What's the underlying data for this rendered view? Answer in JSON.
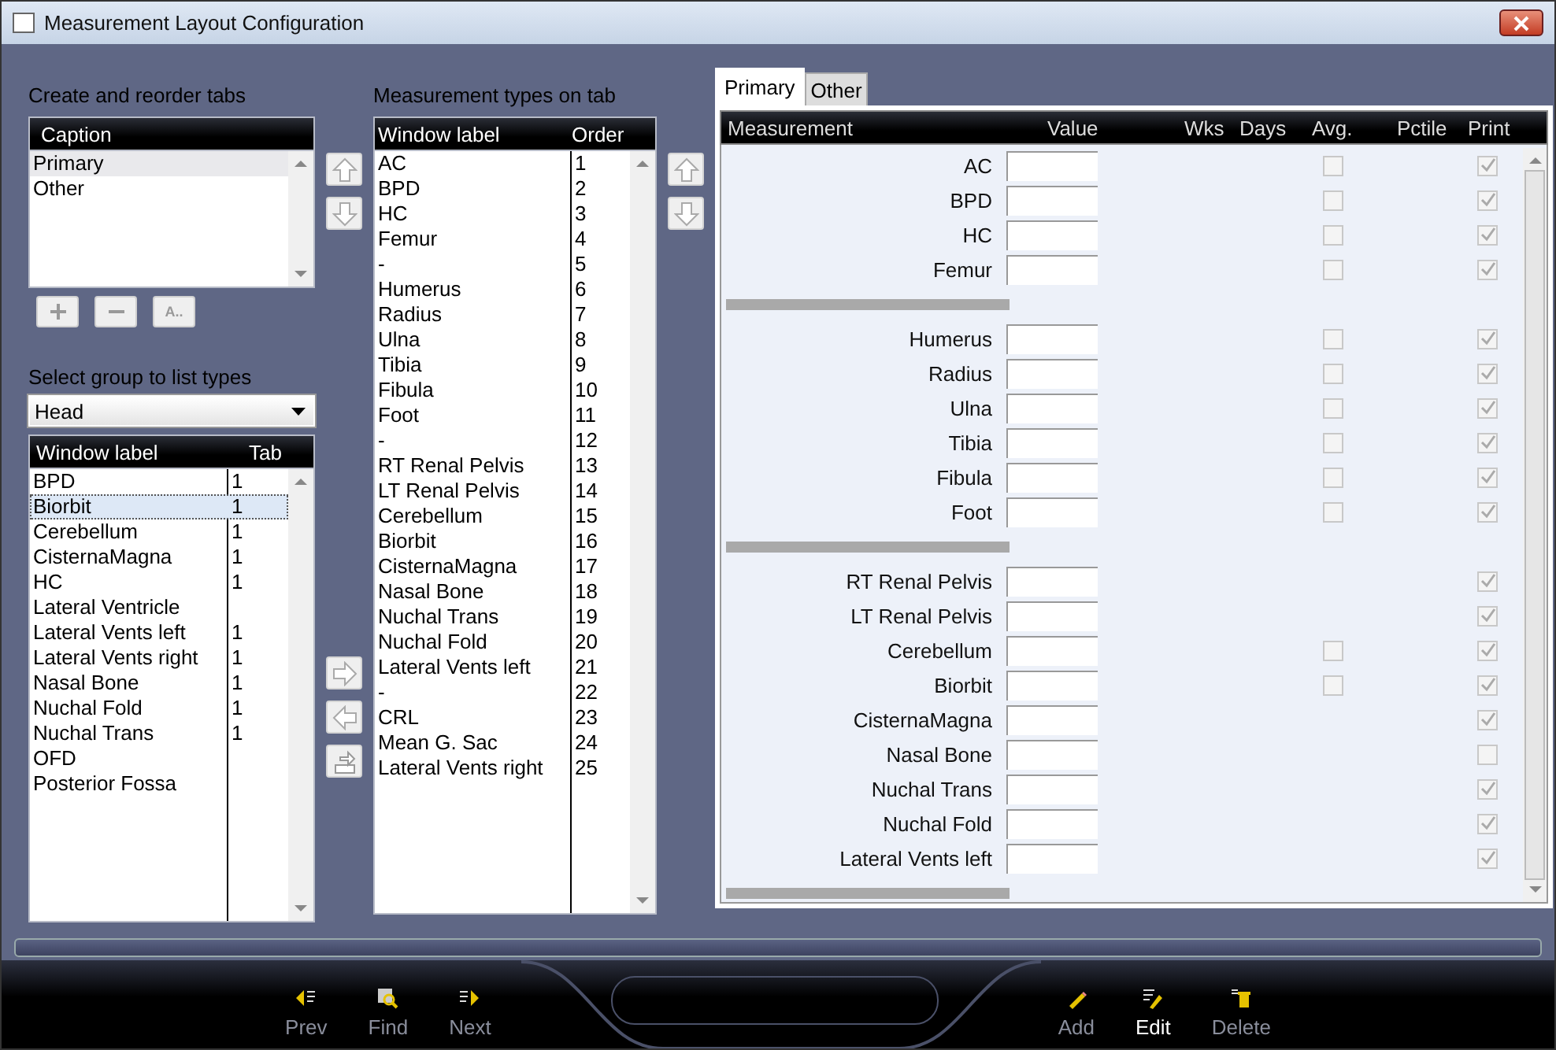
{
  "window": {
    "title": "Measurement Layout Configuration"
  },
  "tabs_editor": {
    "heading": "Create and reorder tabs",
    "column": "Caption",
    "items": [
      {
        "label": "Primary",
        "selected": true
      },
      {
        "label": "Other",
        "selected": false
      }
    ],
    "buttons": [
      {
        "kind": "add"
      },
      {
        "kind": "remove"
      },
      {
        "kind": "rename",
        "label": "A.."
      }
    ]
  },
  "group_picker": {
    "heading": "Select group to list types",
    "value": "Head",
    "columns": [
      "Window label",
      "Tab"
    ],
    "rows": [
      {
        "label": "BPD",
        "tab": "1",
        "selected": false
      },
      {
        "label": "Biorbit",
        "tab": "1",
        "selected": true
      },
      {
        "label": "Cerebellum",
        "tab": "1",
        "selected": false
      },
      {
        "label": "CisternaMagna",
        "tab": "1",
        "selected": false
      },
      {
        "label": "HC",
        "tab": "1",
        "selected": false
      },
      {
        "label": "Lateral Ventricle",
        "selected": false
      },
      {
        "label": "Lateral Vents left",
        "tab": "1",
        "selected": false
      },
      {
        "label": "Lateral Vents right",
        "tab": "1",
        "selected": false
      },
      {
        "label": "Nasal Bone",
        "tab": "1",
        "selected": false
      },
      {
        "label": "Nuchal Fold",
        "tab": "1",
        "selected": false
      },
      {
        "label": "Nuchal Trans",
        "tab": "1",
        "selected": false
      },
      {
        "label": "OFD",
        "selected": false
      },
      {
        "label": "Posterior Fossa",
        "selected": false
      }
    ]
  },
  "types_on_tab": {
    "heading": "Measurement types on tab",
    "columns": [
      "Window label",
      "Order"
    ],
    "rows": [
      {
        "label": "AC",
        "order": "1"
      },
      {
        "label": "BPD",
        "order": "2"
      },
      {
        "label": "HC",
        "order": "3"
      },
      {
        "label": "Femur",
        "order": "4"
      },
      {
        "label": "-",
        "order": "5"
      },
      {
        "label": "Humerus",
        "order": "6"
      },
      {
        "label": "Radius",
        "order": "7"
      },
      {
        "label": "Ulna",
        "order": "8"
      },
      {
        "label": "Tibia",
        "order": "9"
      },
      {
        "label": "Fibula",
        "order": "10"
      },
      {
        "label": "Foot",
        "order": "11"
      },
      {
        "label": "-",
        "order": "12"
      },
      {
        "label": "RT Renal Pelvis",
        "order": "13"
      },
      {
        "label": "LT Renal Pelvis",
        "order": "14"
      },
      {
        "label": "Cerebellum",
        "order": "15"
      },
      {
        "label": "Biorbit",
        "order": "16"
      },
      {
        "label": "CisternaMagna",
        "order": "17"
      },
      {
        "label": "Nasal Bone",
        "order": "18"
      },
      {
        "label": "Nuchal Trans",
        "order": "19"
      },
      {
        "label": "Nuchal Fold",
        "order": "20"
      },
      {
        "label": "Lateral Vents left",
        "order": "21"
      },
      {
        "label": "-",
        "order": "22"
      },
      {
        "label": "CRL",
        "order": "23"
      },
      {
        "label": "Mean G. Sac",
        "order": "24"
      },
      {
        "label": "Lateral Vents right",
        "order": "25"
      }
    ]
  },
  "preview": {
    "tabs": [
      {
        "label": "Primary",
        "selected": true
      },
      {
        "label": "Other",
        "selected": false
      }
    ],
    "columns": [
      "Measurement",
      "Value",
      "Wks",
      "Days",
      "Avg.",
      "Pctile",
      "Print"
    ],
    "rows": [
      {
        "kind": "row",
        "label": "AC",
        "avg": {
          "checked": false
        },
        "print": true
      },
      {
        "kind": "row",
        "label": "BPD",
        "avg": {
          "checked": false
        },
        "print": true
      },
      {
        "kind": "row",
        "label": "HC",
        "avg": {
          "checked": false
        },
        "print": true
      },
      {
        "kind": "row",
        "label": "Femur",
        "avg": {
          "checked": false
        },
        "print": true
      },
      {
        "kind": "separator"
      },
      {
        "kind": "row",
        "label": "Humerus",
        "avg": {
          "checked": false
        },
        "print": true
      },
      {
        "kind": "row",
        "label": "Radius",
        "avg": {
          "checked": false
        },
        "print": true
      },
      {
        "kind": "row",
        "label": "Ulna",
        "avg": {
          "checked": false
        },
        "print": true
      },
      {
        "kind": "row",
        "label": "Tibia",
        "avg": {
          "checked": false
        },
        "print": true
      },
      {
        "kind": "row",
        "label": "Fibula",
        "avg": {
          "checked": false
        },
        "print": true
      },
      {
        "kind": "row",
        "label": "Foot",
        "avg": {
          "checked": false
        },
        "print": true
      },
      {
        "kind": "separator"
      },
      {
        "kind": "row",
        "label": "RT Renal Pelvis",
        "print": true
      },
      {
        "kind": "row",
        "label": "LT Renal Pelvis",
        "print": true
      },
      {
        "kind": "row",
        "label": "Cerebellum",
        "avg": {
          "checked": false
        },
        "print": true
      },
      {
        "kind": "row",
        "label": "Biorbit",
        "avg": {
          "checked": false
        },
        "print": true
      },
      {
        "kind": "row",
        "label": "CisternaMagna",
        "print": true
      },
      {
        "kind": "row",
        "label": "Nasal Bone",
        "print": false
      },
      {
        "kind": "row",
        "label": "Nuchal Trans",
        "print": true
      },
      {
        "kind": "row",
        "label": "Nuchal Fold",
        "print": true
      },
      {
        "kind": "row",
        "label": "Lateral Vents left",
        "print": true
      },
      {
        "kind": "separator"
      }
    ]
  },
  "toolbar": [
    {
      "kind": "prev",
      "label": "Prev",
      "disabled": true
    },
    {
      "kind": "find",
      "label": "Find",
      "disabled": true
    },
    {
      "kind": "next",
      "label": "Next",
      "disabled": true
    },
    {
      "kind": "add",
      "label": "Add",
      "disabled": true
    },
    {
      "kind": "edit",
      "label": "Edit",
      "disabled": false
    },
    {
      "kind": "delete",
      "label": "Delete",
      "disabled": true
    }
  ]
}
